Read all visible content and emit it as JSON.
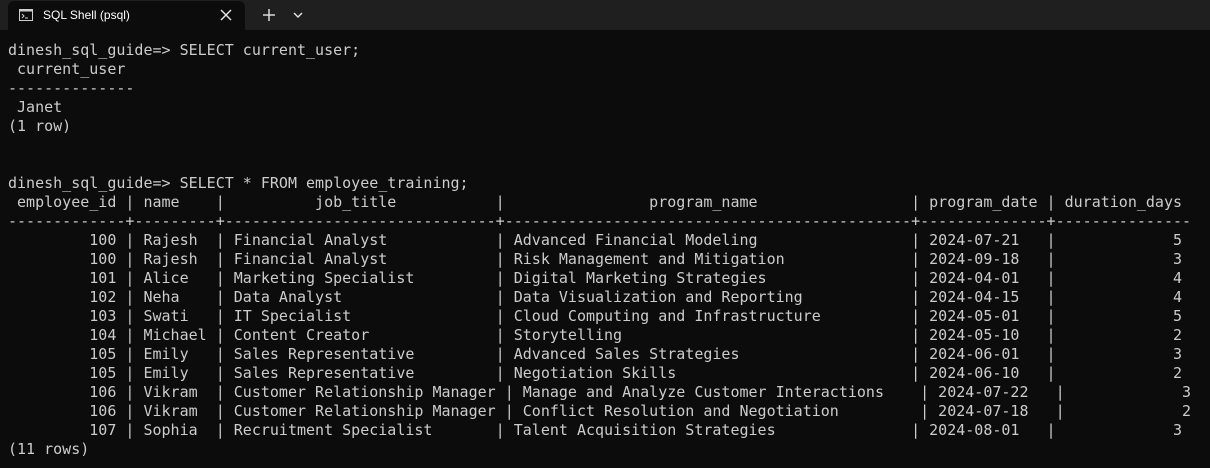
{
  "tab": {
    "title": "SQL Shell (psql)",
    "icon": "terminal-icon",
    "close_icon": "close-icon",
    "new_tab_icon": "plus-icon",
    "dropdown_icon": "chevron-down-icon"
  },
  "colors": {
    "console_bg": "#0c0c0c",
    "tabstrip_bg": "#1f1f1f",
    "text": "#cccccc"
  },
  "console": {
    "lines": [
      "dinesh_sql_guide=> SELECT current_user;",
      " current_user",
      "--------------",
      " Janet",
      "(1 row)",
      "",
      "",
      "dinesh_sql_guide=> SELECT * FROM employee_training;",
      " employee_id | name    |          job_title           |                program_name                 | program_date | duration_days",
      "-------------+---------+------------------------------+---------------------------------------------+--------------+---------------",
      "         100 | Rajesh  | Financial Analyst            | Advanced Financial Modeling                 | 2024-07-21   |             5",
      "         100 | Rajesh  | Financial Analyst            | Risk Management and Mitigation              | 2024-09-18   |             3",
      "         101 | Alice   | Marketing Specialist         | Digital Marketing Strategies                | 2024-04-01   |             4",
      "         102 | Neha    | Data Analyst                 | Data Visualization and Reporting            | 2024-04-15   |             4",
      "         103 | Swati   | IT Specialist                | Cloud Computing and Infrastructure          | 2024-05-01   |             5",
      "         104 | Michael | Content Creator              | Storytelling                                | 2024-05-10   |             2",
      "         105 | Emily   | Sales Representative         | Advanced Sales Strategies                   | 2024-06-01   |             3",
      "         105 | Emily   | Sales Representative         | Negotiation Skills                          | 2024-06-10   |             2",
      "         106 | Vikram  | Customer Relationship Manager | Manage and Analyze Customer Interactions    | 2024-07-22   |             3",
      "         106 | Vikram  | Customer Relationship Manager | Conflict Resolution and Negotiation         | 2024-07-18   |             2",
      "         107 | Sophia  | Recruitment Specialist       | Talent Acquisition Strategies               | 2024-08-01   |             3",
      "(11 rows)"
    ]
  }
}
